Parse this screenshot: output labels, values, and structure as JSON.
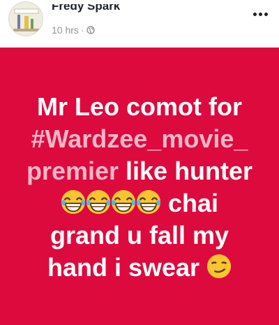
{
  "post": {
    "author": "Fredy Spark",
    "time": "10 hrs",
    "separator": "·",
    "text": {
      "line1": "Mr Leo comot for",
      "hashtag_part1": "#Wardzee_movie_",
      "hashtag_part2": "premier",
      "line3_rest": " like hunter",
      "line4_rest": " chai",
      "line5": "grand u fall my",
      "line6": "hand i swear "
    },
    "background_color": "#dc0a3d",
    "hashtag_color": "#f7b7c8",
    "icons": [
      "more-icon",
      "globe-icon",
      "laughing-emoji-icon",
      "smirk-emoji-icon"
    ]
  }
}
